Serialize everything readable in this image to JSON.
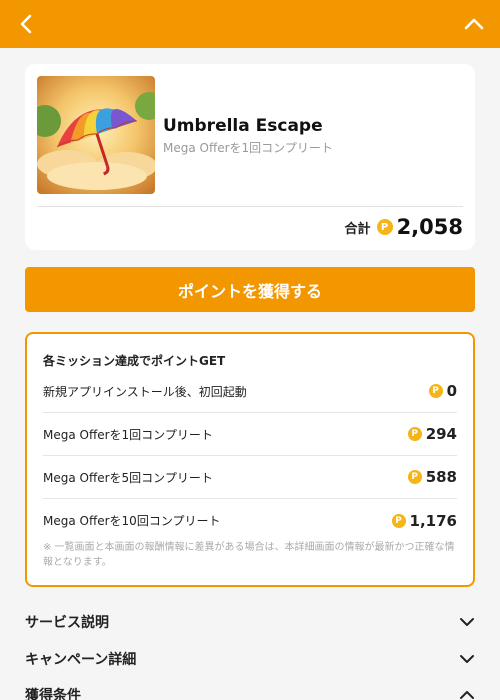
{
  "header": {
    "back_icon": "chevron-left-icon",
    "collapse_icon": "chevron-up-icon",
    "bg": "#f39700"
  },
  "offer": {
    "title": "Umbrella Escape",
    "subtitle": "Mega Offerを1回コンプリート",
    "total_label": "合計",
    "total_value": "2,058",
    "point_icon": "P"
  },
  "cta": {
    "label": "ポイントを獲得する"
  },
  "missions": {
    "title": "各ミッション達成でポイントGET",
    "items": [
      {
        "label": "新規アプリインストール後、初回起動",
        "points": "0"
      },
      {
        "label": "Mega Offerを1回コンプリート",
        "points": "294"
      },
      {
        "label": "Mega Offerを5回コンプリート",
        "points": "588"
      },
      {
        "label": "Mega Offerを10回コンプリート",
        "points": "1,176"
      }
    ],
    "note": "※ 一覧画面と本画面の報酬情報に差異がある場合は、本詳細画面の情報が最新かつ正確な情報となります。"
  },
  "sections": [
    {
      "label": "サービス説明",
      "icon": "chevron-down-icon"
    },
    {
      "label": "キャンペーン詳細",
      "icon": "chevron-down-icon"
    },
    {
      "label": "獲得条件",
      "icon": "chevron-up-icon"
    }
  ],
  "colors": {
    "accent": "#f39700",
    "coin": "#f5b417"
  }
}
